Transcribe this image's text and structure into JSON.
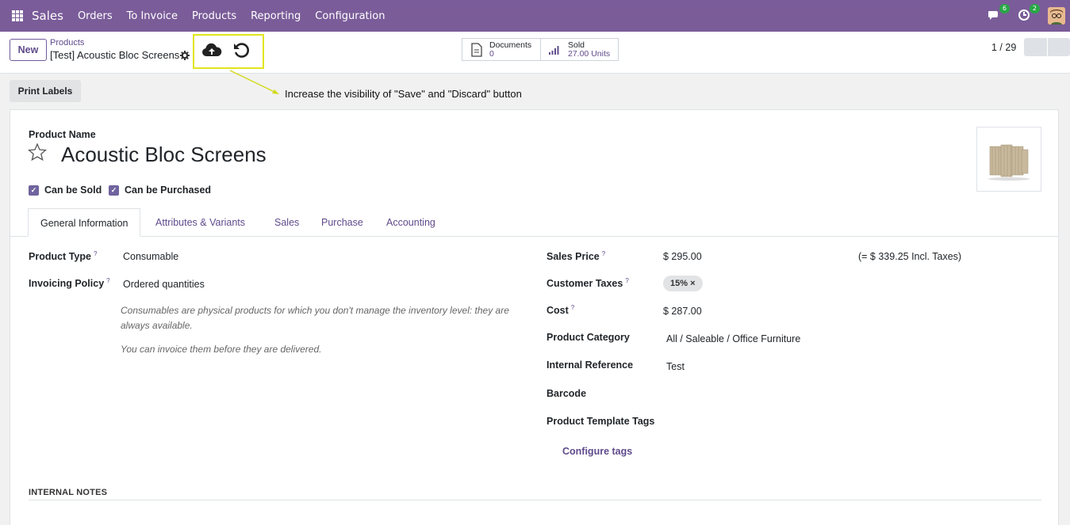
{
  "navbar": {
    "brand": "Sales",
    "menu": [
      "Orders",
      "To Invoice",
      "Products",
      "Reporting",
      "Configuration"
    ],
    "messages_count": "6",
    "activities_count": "2"
  },
  "control": {
    "new_label": "New",
    "breadcrumb_parent": "Products",
    "breadcrumb_current": "[Test] Acoustic Bloc Screens",
    "documents_label": "Documents",
    "documents_value": "0",
    "sold_label": "Sold",
    "sold_value": "27.00 Units",
    "pager": "1 / 29"
  },
  "print_labels": "Print Labels",
  "annotation": "Increase the visibility of \"Save\" and \"Discard\" button",
  "form": {
    "product_name_label": "Product Name",
    "product_name": "Acoustic Bloc Screens",
    "can_be_sold": "Can be Sold",
    "can_be_purchased": "Can be Purchased",
    "tabs": [
      "General Information",
      "Attributes & Variants",
      "Sales",
      "Purchase",
      "Accounting"
    ],
    "left": {
      "product_type_label": "Product Type",
      "product_type": "Consumable",
      "invoicing_policy_label": "Invoicing Policy",
      "invoicing_policy": "Ordered quantities",
      "help_1": "Consumables are physical products for which you don't manage the inventory level: they are always available.",
      "help_2": "You can invoice them before they are delivered."
    },
    "right": {
      "sales_price_label": "Sales Price",
      "sales_price": "$ 295.00",
      "incl_taxes": "(= $ 339.25 Incl. Taxes)",
      "customer_taxes_label": "Customer Taxes",
      "customer_tax_tag": "15% ×",
      "cost_label": "Cost",
      "cost": "$ 287.00",
      "product_category_label": "Product Category",
      "product_category": "All / Saleable / Office Furniture",
      "internal_reference_label": "Internal Reference",
      "internal_reference": "Test",
      "barcode_label": "Barcode",
      "tags_label": "Product Template Tags",
      "configure_tags": "Configure tags"
    },
    "internal_notes": "INTERNAL NOTES",
    "help_marker": "?"
  }
}
